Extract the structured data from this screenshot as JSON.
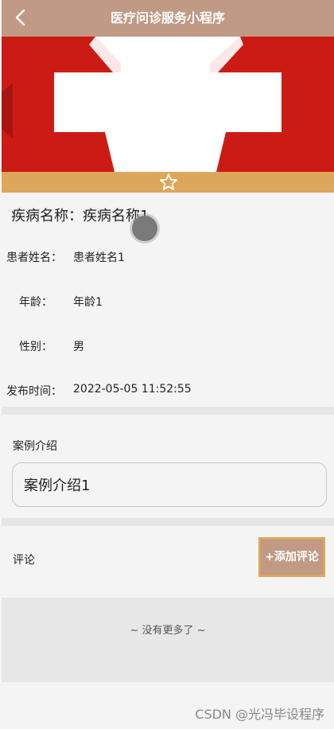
{
  "header": {
    "title": "医疗问诊服务小程序"
  },
  "disease": {
    "label": "疾病名称：",
    "value": "疾病名称1"
  },
  "fields": [
    {
      "label": "患者姓名：",
      "value": "患者姓名1"
    },
    {
      "label": "年龄：",
      "value": "年龄1"
    },
    {
      "label": "性别：",
      "value": "男"
    },
    {
      "label": "发布时间：",
      "value": "2022-05-05 11:52:55"
    }
  ],
  "intro": {
    "title": "案例介绍",
    "content": "案例介绍1"
  },
  "comments": {
    "title": "评论",
    "add_label": "+添加评论",
    "empty_text": "~ 没有更多了 ~"
  },
  "watermark": "CSDN @光冯毕设程序",
  "colors": {
    "header": "#c09a85",
    "accent": "#dca75a",
    "banner_red": "#cc1b14"
  }
}
